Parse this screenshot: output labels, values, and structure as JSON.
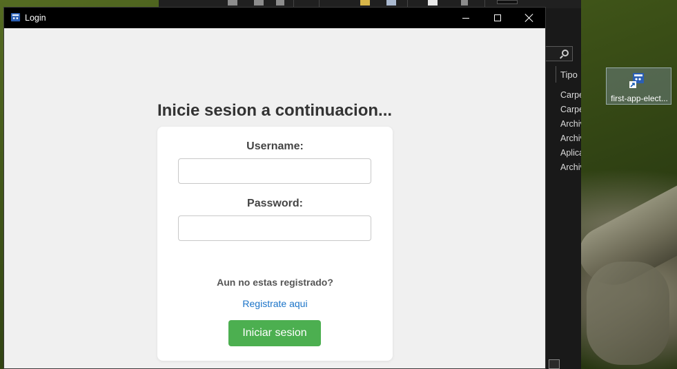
{
  "desktop": {
    "shortcut_label": "first-app-elect..."
  },
  "explorer": {
    "column_header": "Tipo",
    "type_items": [
      "Carpe",
      "Carpe",
      "Archiv",
      "Archiv",
      "Aplica",
      "Archiv"
    ]
  },
  "window": {
    "title": "Login",
    "icon": "electron-app-icon"
  },
  "login": {
    "heading": "Inicie sesion a continuacion...",
    "username_label": "Username:",
    "username_value": "",
    "password_label": "Password:",
    "password_value": "",
    "register_question": "Aun no estas registrado?",
    "register_link": "Registrate aqui",
    "submit_label": "Iniciar sesion"
  },
  "colors": {
    "button": "#4caf50",
    "link": "#1a73c8",
    "titlebar": "#000000",
    "window_bg": "#f0f0f0"
  }
}
